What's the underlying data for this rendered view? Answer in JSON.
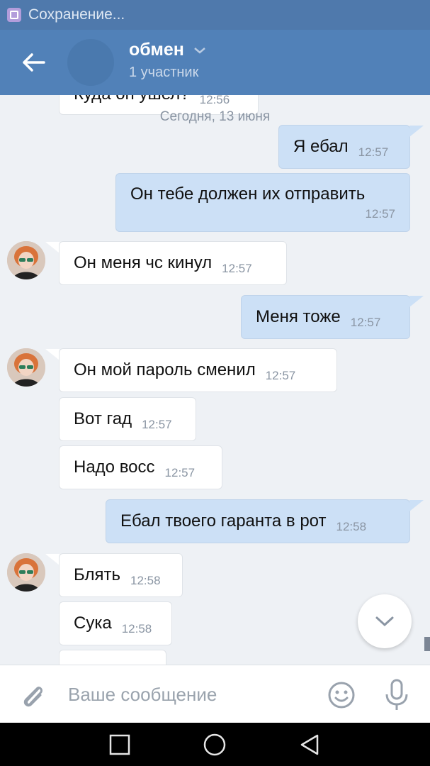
{
  "status_bar": {
    "text": "Сохранение...",
    "icon": "gallery-save-icon"
  },
  "header": {
    "back_icon": "arrow-left-icon",
    "title": "обмен",
    "subtitle": "1 участник",
    "colors": {
      "bar": "#5181b8",
      "status": "#4f79ac"
    }
  },
  "chat": {
    "date_separator": "Сегодня, 13 июня",
    "top_partial": {
      "text": "Куда он ушел?",
      "time": "12:56"
    },
    "messages": [
      {
        "text": "Я ебал",
        "time": "12:57",
        "dir": "out"
      },
      {
        "text": "Он тебе должен их отправить",
        "time": "12:57",
        "dir": "out"
      },
      {
        "text": "Он меня чс кинул",
        "time": "12:57",
        "dir": "in"
      },
      {
        "text": "Меня тоже",
        "time": "12:57",
        "dir": "out"
      },
      {
        "text": "Он мой пароль сменил",
        "time": "12:57",
        "dir": "in"
      },
      {
        "text": "Вот гад",
        "time": "12:57",
        "dir": "in"
      },
      {
        "text": "Надо восс",
        "time": "12:57",
        "dir": "in"
      },
      {
        "text": "Ебал твоего гаранта в рот",
        "time": "12:58",
        "dir": "out"
      },
      {
        "text": "Блять",
        "time": "12:58",
        "dir": "in"
      },
      {
        "text": "Сука",
        "time": "12:58",
        "dir": "in"
      }
    ]
  },
  "composer": {
    "placeholder": "Ваше сообщение",
    "icons": [
      "paperclip-icon",
      "emoji-icon",
      "microphone-icon"
    ]
  },
  "scroll_down_icon": "chevron-down-icon",
  "navbar": {
    "icons": [
      "recent-apps-icon",
      "home-icon",
      "back-triangle-icon"
    ]
  }
}
